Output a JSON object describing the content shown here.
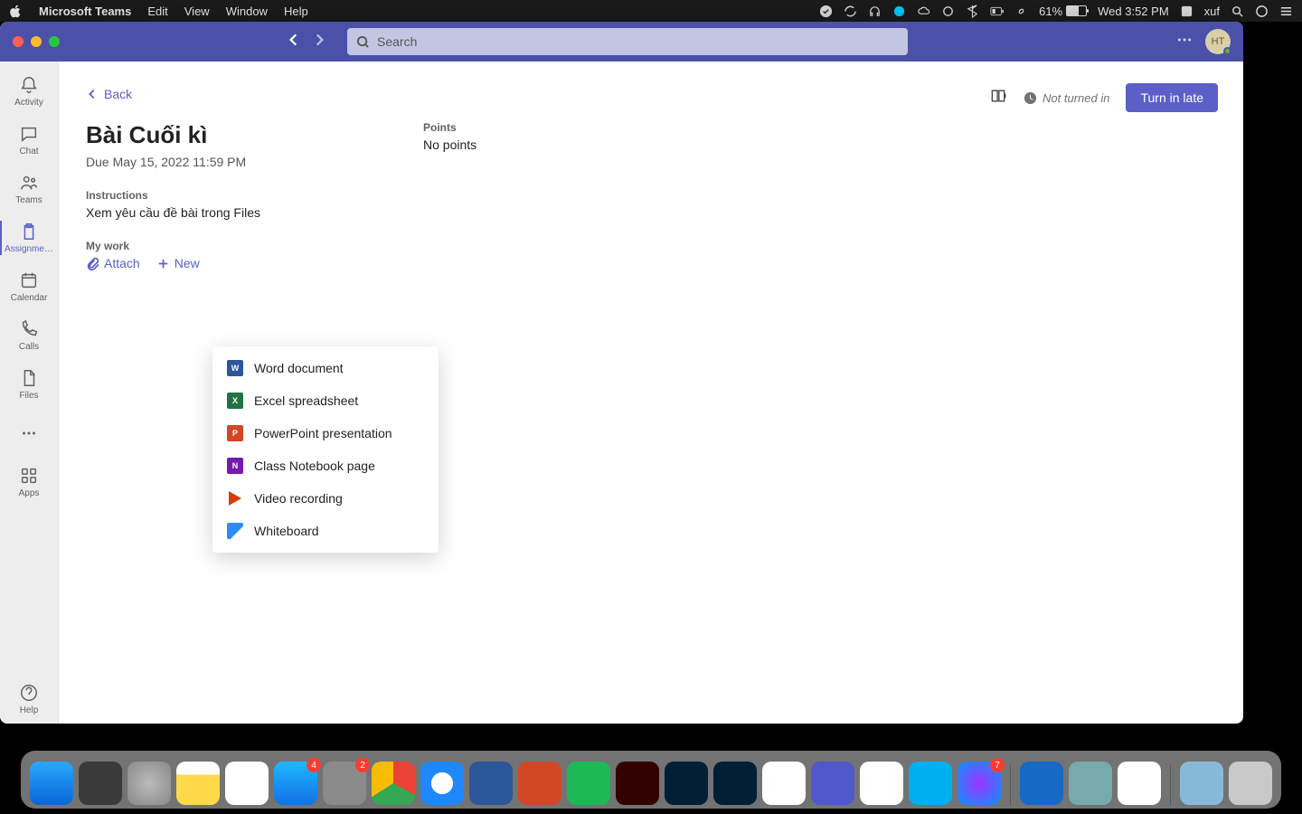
{
  "menubar": {
    "app": "Microsoft Teams",
    "items": [
      "Edit",
      "View",
      "Window",
      "Help"
    ],
    "battery_pct": "61%",
    "datetime": "Wed 3:52 PM",
    "user": "xuf"
  },
  "titlebar": {
    "search_placeholder": "Search"
  },
  "avatar": {
    "initials": "HT"
  },
  "rail": {
    "items": [
      {
        "key": "activity",
        "label": "Activity"
      },
      {
        "key": "chat",
        "label": "Chat"
      },
      {
        "key": "teams",
        "label": "Teams"
      },
      {
        "key": "assignments",
        "label": "Assignme…"
      },
      {
        "key": "calendar",
        "label": "Calendar"
      },
      {
        "key": "calls",
        "label": "Calls"
      },
      {
        "key": "files",
        "label": "Files"
      }
    ],
    "more": "",
    "apps_label": "Apps",
    "help_label": "Help",
    "selected": "assignments"
  },
  "assignment": {
    "back_label": "Back",
    "title": "Bài Cuối kì",
    "due": "Due May 15, 2022 11:59 PM",
    "instructions_label": "Instructions",
    "instructions": "Xem yêu cầu đề bài trong Files",
    "mywork_label": "My work",
    "attach_label": "Attach",
    "new_label": "New",
    "points_label": "Points",
    "points_value": "No points",
    "status": "Not turned in",
    "turnin_label": "Turn in late"
  },
  "new_menu": {
    "items": [
      {
        "kind": "word",
        "label": "Word document"
      },
      {
        "kind": "excel",
        "label": "Excel spreadsheet"
      },
      {
        "kind": "ppt",
        "label": "PowerPoint presentation"
      },
      {
        "kind": "note",
        "label": "Class Notebook page"
      },
      {
        "kind": "vid",
        "label": "Video recording"
      },
      {
        "kind": "wb",
        "label": "Whiteboard"
      }
    ]
  },
  "dock": {
    "apps": [
      {
        "name": "finder",
        "bg": "linear-gradient(#2aa9ff,#0a65d6)"
      },
      {
        "name": "unknown-red",
        "bg": "#3a3a3a",
        "badge": ""
      },
      {
        "name": "launchpad",
        "bg": "radial-gradient(circle,#bbb,#888)"
      },
      {
        "name": "notes",
        "bg": "linear-gradient(#fff 30%,#ffd94a 30%)"
      },
      {
        "name": "calendar",
        "bg": "#fff",
        "badge": ""
      },
      {
        "name": "appstore",
        "bg": "linear-gradient(#1fb8ff,#1271e6)",
        "badge": "4"
      },
      {
        "name": "settings",
        "bg": "#8a8a8a",
        "badge": "2"
      },
      {
        "name": "chrome",
        "bg": "conic-gradient(#ea4335 0 33%,#34a853 0 66%,#fbbc05 0)"
      },
      {
        "name": "safari",
        "bg": "radial-gradient(circle,#fff 35%,#1e88ff 36%)"
      },
      {
        "name": "word",
        "bg": "#2b579a"
      },
      {
        "name": "powerpoint",
        "bg": "#d24726"
      },
      {
        "name": "spotify",
        "bg": "#1db954"
      },
      {
        "name": "illustrator",
        "bg": "#330000"
      },
      {
        "name": "lightroom",
        "bg": "#001e36"
      },
      {
        "name": "photoshop",
        "bg": "#001e36"
      },
      {
        "name": "ultraviewer",
        "bg": "#fff"
      },
      {
        "name": "teams",
        "bg": "#5059c9"
      },
      {
        "name": "zalo",
        "bg": "#fff"
      },
      {
        "name": "skype",
        "bg": "#00aff0"
      },
      {
        "name": "messenger",
        "bg": "radial-gradient(circle,#a033ff,#0695ff)",
        "badge": "7"
      },
      {
        "name": "sep",
        "sep": true
      },
      {
        "name": "teamviewer",
        "bg": "#1769c6"
      },
      {
        "name": "preview",
        "bg": "#7aa"
      },
      {
        "name": "openvpn",
        "bg": "#fff"
      },
      {
        "name": "sep2",
        "sep": true
      },
      {
        "name": "downloads",
        "bg": "#89b9d8"
      },
      {
        "name": "trash",
        "bg": "#c9c9c9"
      }
    ]
  }
}
